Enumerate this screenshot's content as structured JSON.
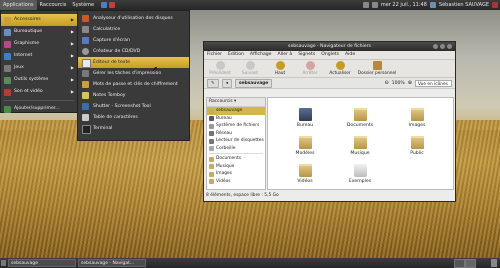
{
  "top_panel": {
    "menus": [
      "Applications",
      "Raccourcis",
      "Système"
    ],
    "clock": "mer 22 juil., 11:48",
    "user": "Sébastien SAUVAGE"
  },
  "apps_menu": {
    "items": [
      {
        "label": "Accessoires",
        "icon": "accessories-icon",
        "color": "#c9a13a"
      },
      {
        "label": "Bureautique",
        "icon": "office-icon",
        "color": "#6a8fbf"
      },
      {
        "label": "Graphisme",
        "icon": "graphics-icon",
        "color": "#b44a8a"
      },
      {
        "label": "Internet",
        "icon": "internet-icon",
        "color": "#3d7fc4"
      },
      {
        "label": "Jeux",
        "icon": "games-icon",
        "color": "#7a7a7a"
      },
      {
        "label": "Outils système",
        "icon": "system-tools-icon",
        "color": "#5d8a5d"
      },
      {
        "label": "Son et vidéo",
        "icon": "sound-video-icon",
        "color": "#b53a3a"
      }
    ],
    "footer": "Ajouter/supprimer..."
  },
  "accessories_menu": {
    "items": [
      {
        "label": "Analyseur d'utilisation des disques",
        "color": "#c85a2a"
      },
      {
        "label": "Calculatrice",
        "color": "#888888"
      },
      {
        "label": "Capture d'écran",
        "color": "#5a7abf"
      },
      {
        "label": "Créateur de CD/DVD",
        "color": "#999999"
      },
      {
        "label": "Éditeur de texte",
        "color": "#e9e9e9"
      },
      {
        "label": "Gérer les tâches d'impression",
        "color": "#7a7a7a"
      },
      {
        "label": "Mots de passe et clés de chiffrement",
        "color": "#c9a13a"
      },
      {
        "label": "Notes Tomboy",
        "color": "#d6c35a"
      },
      {
        "label": "Shutter - Screenshot Tool",
        "color": "#3b6ea8"
      },
      {
        "label": "Table de caractères",
        "color": "#cccccc"
      },
      {
        "label": "Terminal",
        "color": "#222222"
      }
    ]
  },
  "file_window": {
    "title": "sebsauvage - Navigateur de fichiers",
    "menubar": [
      "Fichier",
      "Édition",
      "Affichage",
      "Aller à",
      "Signets",
      "Onglets",
      "Aide"
    ],
    "toolbar": [
      {
        "label": "Précédent",
        "enabled": false
      },
      {
        "label": "Suivant",
        "enabled": false
      },
      {
        "label": "Haut",
        "enabled": true
      },
      {
        "label": "Arrêter",
        "enabled": false
      },
      {
        "label": "Actualiser",
        "enabled": true
      },
      {
        "label": "Dossier personnel",
        "enabled": true
      }
    ],
    "location": "sebsauvage",
    "zoom": "100%",
    "view_mode": "Vue en icônes",
    "sidebar_mode": "Raccourcis",
    "sidebar": {
      "places": [
        "sebsauvage",
        "Bureau",
        "Système de fichiers",
        "Réseau",
        "Lecteur de disquettes",
        "Corbeille"
      ],
      "bookmarks": [
        "Documents",
        "Musique",
        "Images",
        "Vidéos"
      ]
    },
    "files": [
      {
        "label": "Bureau",
        "type": "desktop"
      },
      {
        "label": "Documents",
        "type": "folder"
      },
      {
        "label": "Images",
        "type": "folder"
      },
      {
        "label": "Modèles",
        "type": "folder"
      },
      {
        "label": "Musique",
        "type": "folder"
      },
      {
        "label": "Public",
        "type": "folder"
      },
      {
        "label": "Vidéos",
        "type": "folder"
      },
      {
        "label": "Exemples",
        "type": "examples"
      }
    ],
    "status": "8 éléments, espace libre : 5,5 Go"
  },
  "taskbar": {
    "tasks": [
      "sebsauvage",
      "sebsauvage - Navigat..."
    ]
  }
}
